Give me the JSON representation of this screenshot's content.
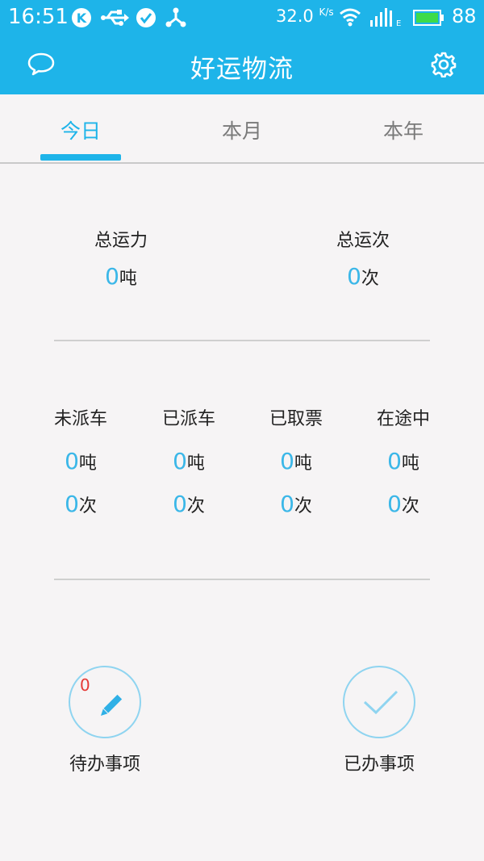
{
  "status_bar": {
    "time": "16:51",
    "speed": "32.0",
    "speed_unit": "K/s",
    "battery_percent": "88",
    "icons": [
      "k-app-icon",
      "usb-icon",
      "check-circle-icon",
      "share-icon",
      "wifi-icon",
      "signal-icon",
      "battery-icon"
    ]
  },
  "app_bar": {
    "title": "好运物流",
    "left_icon": "chat-bubble-icon",
    "right_icon": "gear-icon"
  },
  "tabs": [
    {
      "label": "今日",
      "active": true
    },
    {
      "label": "本月",
      "active": false
    },
    {
      "label": "本年",
      "active": false
    }
  ],
  "summary": [
    {
      "label": "总运力",
      "value": "0",
      "unit": "吨"
    },
    {
      "label": "总运次",
      "value": "0",
      "unit": "次"
    }
  ],
  "statuses": [
    {
      "label": "未派车",
      "tons": "0",
      "ton_unit": "吨",
      "trips": "0",
      "trip_unit": "次"
    },
    {
      "label": "已派车",
      "tons": "0",
      "ton_unit": "吨",
      "trips": "0",
      "trip_unit": "次"
    },
    {
      "label": "已取票",
      "tons": "0",
      "ton_unit": "吨",
      "trips": "0",
      "trip_unit": "次"
    },
    {
      "label": "在途中",
      "tons": "0",
      "ton_unit": "吨",
      "trips": "0",
      "trip_unit": "次"
    }
  ],
  "actions": [
    {
      "label": "待办事项",
      "badge": "0",
      "icon": "pencil-icon"
    },
    {
      "label": "已办事项",
      "icon": "checkmark-icon"
    }
  ],
  "colors": {
    "primary": "#1eb4e9",
    "value": "#3bb7e8",
    "badge": "#e53935",
    "background": "#f6f4f5"
  }
}
